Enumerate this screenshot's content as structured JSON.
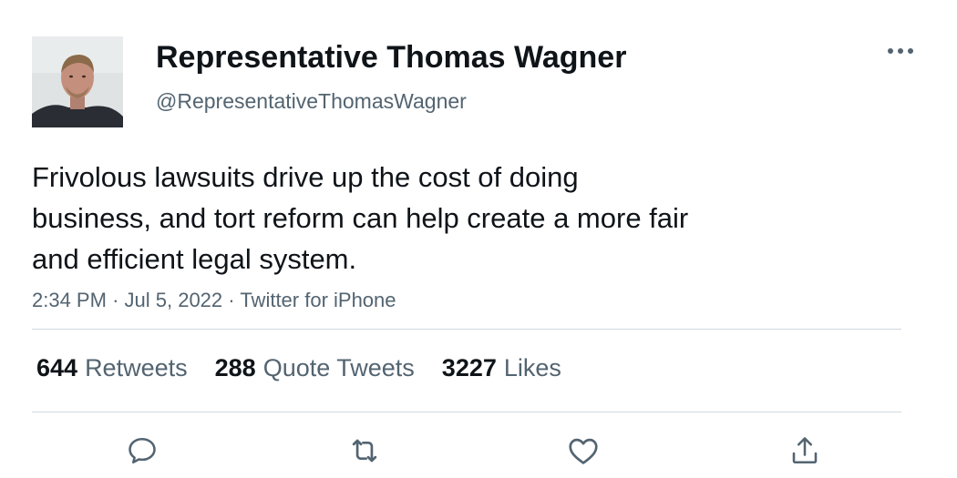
{
  "author": {
    "display_name": "Representative Thomas Wagner",
    "handle": "@RepresentativeThomasWagner",
    "avatar_icon": "profile-photo"
  },
  "menu_icon": "more-dots-icon",
  "tweet": {
    "text_lines": [
      "Frivolous lawsuits drive up the cost of doing",
      "business, and tort reform can help create a more fair",
      "and efficient legal system."
    ],
    "time": "2:34 PM",
    "date": "Jul 5, 2022",
    "source": "Twitter for iPhone",
    "separator": "·"
  },
  "stats": {
    "retweets": {
      "count": "644",
      "label": "Retweets"
    },
    "quote_tweets": {
      "count": "288",
      "label": "Quote Tweets"
    },
    "likes": {
      "count": "3227",
      "label": "Likes"
    }
  },
  "actions": [
    {
      "icon": "reply-icon"
    },
    {
      "icon": "retweet-icon"
    },
    {
      "icon": "like-icon"
    },
    {
      "icon": "share-icon"
    }
  ],
  "colors": {
    "text_primary": "#0f1419",
    "text_secondary": "#536471",
    "divider": "#cfd9de",
    "background": "#ffffff"
  }
}
